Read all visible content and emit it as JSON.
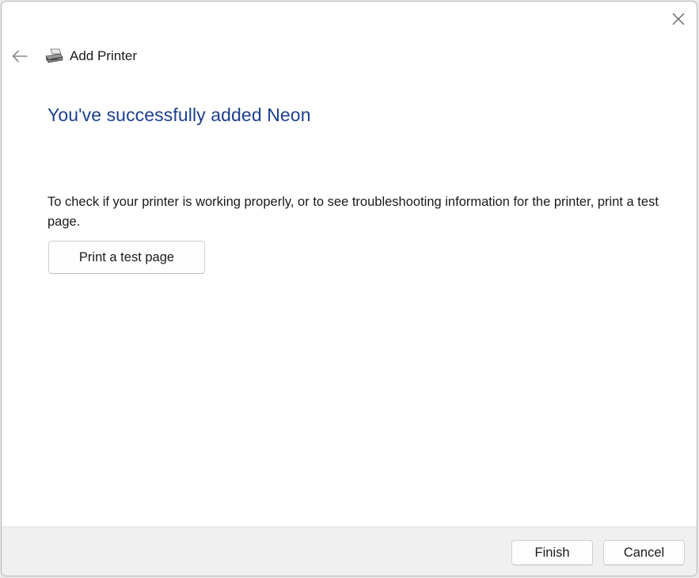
{
  "window": {
    "title": "Add Printer",
    "close_icon": "close-icon",
    "back_icon": "back-arrow-icon",
    "printer_icon": "printer-icon"
  },
  "main": {
    "headline": "You've successfully added Neon",
    "description": "To check if your printer is working properly, or to see troubleshooting information for the printer, print a test page.",
    "test_page_button": "Print a test page"
  },
  "footer": {
    "finish_label": "Finish",
    "cancel_label": "Cancel"
  },
  "colors": {
    "headline": "#1b3f8f",
    "footer_bg": "#f0f0f0",
    "window_bg": "#ffffff"
  }
}
